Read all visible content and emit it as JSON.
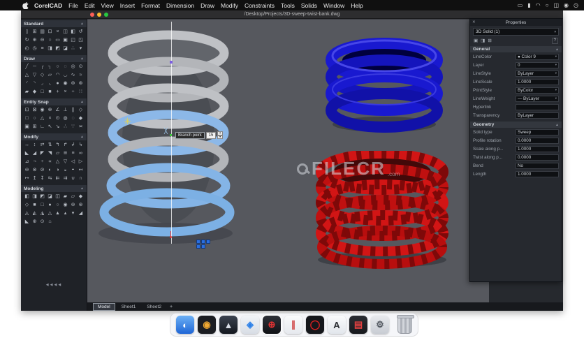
{
  "app": {
    "name": "CorelCAD"
  },
  "menubar": {
    "items": [
      "File",
      "Edit",
      "View",
      "Insert",
      "Format",
      "Dimension",
      "Draw",
      "Modify",
      "Constraints",
      "Tools",
      "Solids",
      "Window",
      "Help"
    ],
    "right_icons": [
      {
        "name": "display-icon",
        "glyph": "▭"
      },
      {
        "name": "battery-icon",
        "glyph": "▮"
      },
      {
        "name": "wifi-icon",
        "glyph": "◠"
      },
      {
        "name": "spotlight-search-icon",
        "glyph": "○"
      },
      {
        "name": "control-center-icon",
        "glyph": "◫"
      },
      {
        "name": "siri-icon",
        "glyph": "◉"
      },
      {
        "name": "clock-icon",
        "glyph": "◷"
      }
    ]
  },
  "window": {
    "title": "/Desktop/Projects/3D-sweep-twist-bank.dwg"
  },
  "toolbar": {
    "collapse_label": "◀◀◀◀",
    "sections": {
      "standard": {
        "title": "Standard",
        "icons": [
          "▯",
          "⊞",
          "▥",
          "⊡",
          "×",
          "◫",
          "◧",
          "↺",
          "↻",
          "⊕",
          "⊖",
          "○",
          "▭",
          "▣",
          "◰",
          "◳",
          "◴",
          "◷",
          "≡",
          "◨",
          "◩",
          "◪",
          "∴",
          "▾"
        ]
      },
      "draw": {
        "title": "Draw",
        "icons": [
          "╱",
          "─",
          "┌",
          "┐",
          "○",
          "◌",
          "◎",
          "⊙",
          "△",
          "▽",
          "◇",
          "▱",
          "◠",
          "◡",
          "∿",
          "≈",
          "◜",
          "◝",
          "◞",
          "◟",
          "●",
          "◉",
          "⊚",
          "⊛",
          "▰",
          "◆",
          "□",
          "■",
          "+",
          "×",
          "÷",
          "∷"
        ]
      },
      "entity_snap": {
        "title": "Entity Snap",
        "icons": [
          "⊡",
          "⊠",
          "◉",
          "⊕",
          "∠",
          "⊥",
          "∥",
          "◇",
          "□",
          "○",
          "△",
          "×",
          "⊙",
          "◍",
          "◌",
          "◆",
          "▣",
          "⊞",
          "∟",
          "↖",
          "↘",
          "∴",
          "∵",
          "≍"
        ]
      },
      "modify": {
        "title": "Modify",
        "icons": [
          "↔",
          "↕",
          "⇄",
          "⇅",
          "↰",
          "↱",
          "↲",
          "↳",
          "◣",
          "◢",
          "◤",
          "◥",
          "▱",
          "≅",
          "≡",
          "∞",
          "⊿",
          "¬",
          "÷",
          "∝",
          "△",
          "▽",
          "◁",
          "▷",
          "⊖",
          "⊗",
          "⊘",
          "◐",
          "◑",
          "◒",
          "◓",
          "↤",
          "↦",
          "↥",
          "↧",
          "⇆",
          "⇇",
          "⇉",
          "∪",
          "∩"
        ]
      },
      "modeling": {
        "title": "Modeling",
        "icons": [
          "◧",
          "◨",
          "◩",
          "◪",
          "◫",
          "▰",
          "▱",
          "◆",
          "◇",
          "■",
          "□",
          "●",
          "○",
          "◉",
          "⊚",
          "⊛",
          "◬",
          "◭",
          "◮",
          "△",
          "▲",
          "▴",
          "▾",
          "◢",
          "◣",
          "⊕",
          "⊙",
          "⌂"
        ]
      }
    }
  },
  "canvas": {
    "tooltip": {
      "label": "Branch point",
      "value": "15"
    },
    "watermark": {
      "text": "FILECR",
      "suffix": ".com"
    }
  },
  "tabs": {
    "items": [
      {
        "label": "Model",
        "active": true
      },
      {
        "label": "Sheet1",
        "active": false
      },
      {
        "label": "Sheet2",
        "active": false
      }
    ],
    "add_label": "+"
  },
  "properties": {
    "title": "Properties",
    "selector": "3D Solid (1)",
    "tools": [
      "▣",
      "◨",
      "⊞"
    ],
    "help_label": "?",
    "general": {
      "title": "General",
      "rows": [
        {
          "label": "LineColor",
          "value": "● Color 9",
          "arrow": true
        },
        {
          "label": "Layer",
          "value": "0",
          "arrow": true
        },
        {
          "label": "LineStyle",
          "value": "ByLayer",
          "arrow": true
        },
        {
          "label": "LineScale",
          "value": "1.0000",
          "arrow": false
        },
        {
          "label": "PrintStyle",
          "value": "ByColor",
          "arrow": true
        },
        {
          "label": "LineWeight",
          "value": "— ByLayer",
          "arrow": true
        },
        {
          "label": "Hyperlink",
          "value": "",
          "arrow": false
        },
        {
          "label": "Transparency",
          "value": "ByLayer",
          "arrow": false
        }
      ]
    },
    "geometry": {
      "title": "Geometry",
      "rows": [
        {
          "label": "Solid type",
          "value": "Sweep",
          "arrow": false
        },
        {
          "label": "Profile rotation",
          "value": "0.0000",
          "arrow": false
        },
        {
          "label": "Scale along p...",
          "value": "1.0000",
          "arrow": false
        },
        {
          "label": "Twist along p...",
          "value": "0.0000",
          "arrow": false
        },
        {
          "label": "Bend",
          "value": "No",
          "arrow": false
        },
        {
          "label": "Length",
          "value": "1.0000",
          "arrow": false
        }
      ]
    }
  },
  "dock": {
    "items": [
      {
        "name": "finder-icon",
        "glyph": "◐",
        "bg": "linear-gradient(180deg,#6cb0f5,#1f66d6)",
        "fg": "#ffffff",
        "active": false
      },
      {
        "name": "photos-icon",
        "glyph": "◉",
        "bg": "#1b1d22",
        "fg": "#f0a832",
        "active": false
      },
      {
        "name": "launchpad-icon",
        "glyph": "▲",
        "bg": "linear-gradient(180deg,#3c4350,#14181f)",
        "fg": "#d8dde6",
        "active": false
      },
      {
        "name": "safari-icon",
        "glyph": "◈",
        "bg": "linear-gradient(180deg,#f2f4f7,#d8dde5)",
        "fg": "#2a7fe8",
        "active": false
      },
      {
        "name": "corelcad-icon",
        "glyph": "⊕",
        "bg": "linear-gradient(180deg,#2e3138,#101216)",
        "fg": "#e23333",
        "active": true
      },
      {
        "name": "design-pens-icon",
        "glyph": "∥",
        "bg": "linear-gradient(180deg,#fafbfc,#e6e9ee)",
        "fg": "#d04545",
        "active": false
      },
      {
        "name": "camera-lens-icon",
        "glyph": "◯",
        "bg": "#15171b",
        "fg": "#e02020",
        "active": false
      },
      {
        "name": "letter-a-app-icon",
        "glyph": "A",
        "bg": "linear-gradient(180deg,#fafbfc,#e2e6ec)",
        "fg": "#2b2e33",
        "active": false
      },
      {
        "name": "display-tool-icon",
        "glyph": "▤",
        "bg": "linear-gradient(180deg,#2a2d33,#17191d)",
        "fg": "#e04040",
        "active": false
      },
      {
        "name": "settings-gear-icon",
        "glyph": "⚙",
        "bg": "linear-gradient(180deg,#e8eaee,#c8ccd3)",
        "fg": "#555b63",
        "active": false
      }
    ]
  },
  "icons": {
    "dropdown_arrow": "▾",
    "collapse_up": "▲",
    "close": "✕",
    "spin_up": "▲",
    "spin_down": "▼",
    "gizmo_star": "✳",
    "snap_cross": "╳"
  },
  "colors": {
    "canvas_bg": "#56585e",
    "spring_gray": "#bfc1c5",
    "spring_selected_blue": "#84b4e6",
    "spring_blue": "#1919d0",
    "spring_red": "#d21515"
  }
}
